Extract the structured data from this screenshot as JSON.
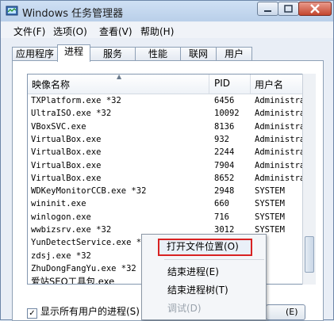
{
  "window": {
    "title": "Windows 任务管理器"
  },
  "menu": [
    {
      "label": "文件(F)"
    },
    {
      "label": "选项(O)"
    },
    {
      "label": "查看(V)"
    },
    {
      "label": "帮助(H)"
    }
  ],
  "tabs": [
    {
      "label": "应用程序",
      "active": false
    },
    {
      "label": "进程",
      "active": true
    },
    {
      "label": "服务",
      "active": false
    },
    {
      "label": "性能",
      "active": false
    },
    {
      "label": "联网",
      "active": false
    },
    {
      "label": "用户",
      "active": false
    }
  ],
  "table": {
    "headers": {
      "name": "映像名称",
      "pid": "PID",
      "user": "用户名"
    },
    "rows": [
      {
        "name": "TXPlatform.exe *32",
        "pid": "6456",
        "user": "Administra"
      },
      {
        "name": "UltraISO.exe *32",
        "pid": "10092",
        "user": "Administra"
      },
      {
        "name": "VBoxSVC.exe",
        "pid": "8136",
        "user": "Administra"
      },
      {
        "name": "VirtualBox.exe",
        "pid": "932",
        "user": "Administra"
      },
      {
        "name": "VirtualBox.exe",
        "pid": "2244",
        "user": "Administra"
      },
      {
        "name": "VirtualBox.exe",
        "pid": "7904",
        "user": "Administra"
      },
      {
        "name": "VirtualBox.exe",
        "pid": "8652",
        "user": "Administra"
      },
      {
        "name": "WDKeyMonitorCCB.exe *32",
        "pid": "2948",
        "user": "SYSTEM"
      },
      {
        "name": "wininit.exe",
        "pid": "660",
        "user": "SYSTEM"
      },
      {
        "name": "winlogon.exe",
        "pid": "716",
        "user": "SYSTEM"
      },
      {
        "name": "wwbizsrv.exe *32",
        "pid": "3012",
        "user": "SYSTEM"
      },
      {
        "name": "YunDetectService.exe *32",
        "pid": "",
        "user": ""
      },
      {
        "name": "zdsj.exe *32",
        "pid": "",
        "user": ""
      },
      {
        "name": "ZhuDongFangYu.exe *32",
        "pid": "",
        "user": ""
      },
      {
        "name": "爱站SEO工具包.exe",
        "pid": "",
        "user": ""
      }
    ]
  },
  "context_menu": {
    "items": [
      {
        "label": "打开文件位置(O)",
        "enabled": true,
        "highlighted": true
      },
      {
        "label": "结束进程(E)",
        "enabled": true
      },
      {
        "label": "结束进程树(T)",
        "enabled": true
      },
      {
        "label": "调试(D)",
        "enabled": false
      }
    ]
  },
  "footer": {
    "show_all_label": "显示所有用户的进程(S)",
    "show_all_checked": true,
    "end_button_label": "(E)"
  },
  "colors": {
    "highlight_border": "#d82222",
    "title_bar": "#b9cfe9",
    "close_button": "#c4472f"
  }
}
